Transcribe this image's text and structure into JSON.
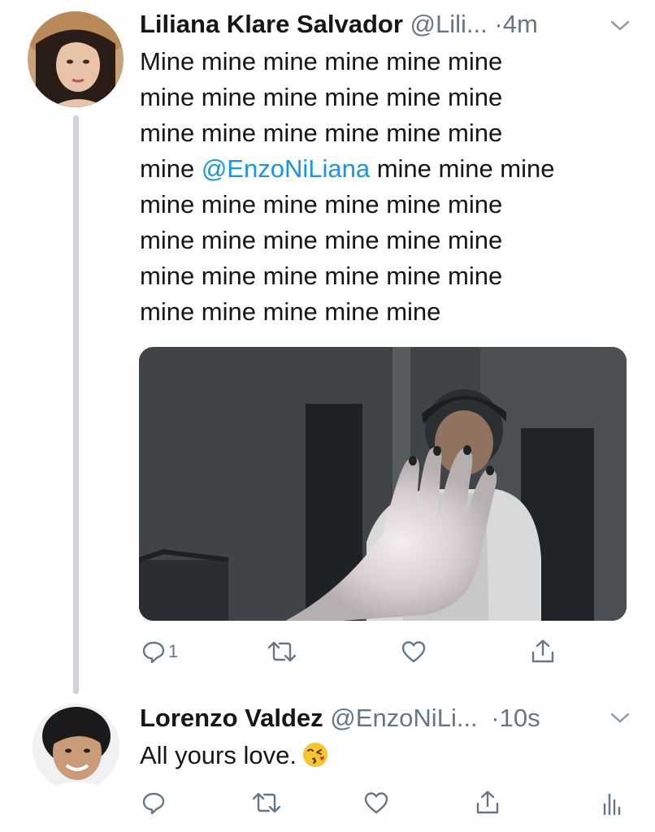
{
  "tweet1": {
    "name": "Liliana Klare Salvador",
    "handle": "@Lili...",
    "dot": "·",
    "time": "4m",
    "lines": [
      "Mine mine mine mine mine mine",
      "mine mine mine mine mine mine",
      "mine mine mine mine mine mine"
    ],
    "line4_before": "mine ",
    "mention": "@EnzoNiLiana",
    "line4_after": " mine mine mine",
    "lines_after": [
      "mine mine mine mine mine mine",
      "mine mine mine mine mine mine",
      "mine mine mine mine mine mine",
      "mine mine mine mine mine"
    ],
    "reply_count": "1"
  },
  "tweet2": {
    "name": "Lorenzo Valdez",
    "handle": "@EnzoNiLi...",
    "dot": "·",
    "time": "10s",
    "text": "All yours love.",
    "emoji": "face-blowing-kiss"
  },
  "icons": {
    "reply": "reply-icon",
    "retweet": "retweet-icon",
    "like": "heart-icon",
    "share": "share-icon",
    "analytics": "analytics-icon",
    "more": "chevron-down-icon"
  },
  "colors": {
    "text": "#14171a",
    "secondary": "#657786",
    "mention": "#1b95e0",
    "thread_line": "#cdd3d9"
  }
}
